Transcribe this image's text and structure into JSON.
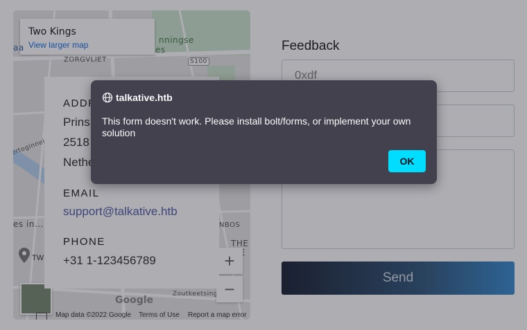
{
  "map": {
    "place_name": "Two Kings",
    "larger_map_link": "View larger map",
    "labels": [
      "ZORGVLIET",
      "S100",
      "nningse",
      "es",
      "Zoutkeetsinge",
      "NBOS",
      "THE",
      "CE",
      "es in...",
      "TW",
      "ertoginnelaan",
      "aa"
    ],
    "zoom_in": "+",
    "zoom_out": "−",
    "google_logo": "Google",
    "footer": {
      "data": "Map data ©2022 Google",
      "terms": "Terms of Use",
      "report": "Report a map error"
    }
  },
  "contact": {
    "address_label": "ADDR",
    "address_lines": [
      "Prins",
      "2518",
      "Nethe"
    ],
    "email_label": "EMAIL",
    "email_value": "support@talkative.htb",
    "phone_label": "PHONE",
    "phone_value": "+31 1-123456789"
  },
  "form": {
    "title": "Feedback",
    "field1_value": "0xdf",
    "send_label": "Send"
  },
  "dialog": {
    "origin": "talkative.htb",
    "message": "This form doesn't work. Please install bolt/forms, or implement your own solution",
    "ok_label": "OK",
    "accent": "#00ddff",
    "background": "#42414d"
  }
}
